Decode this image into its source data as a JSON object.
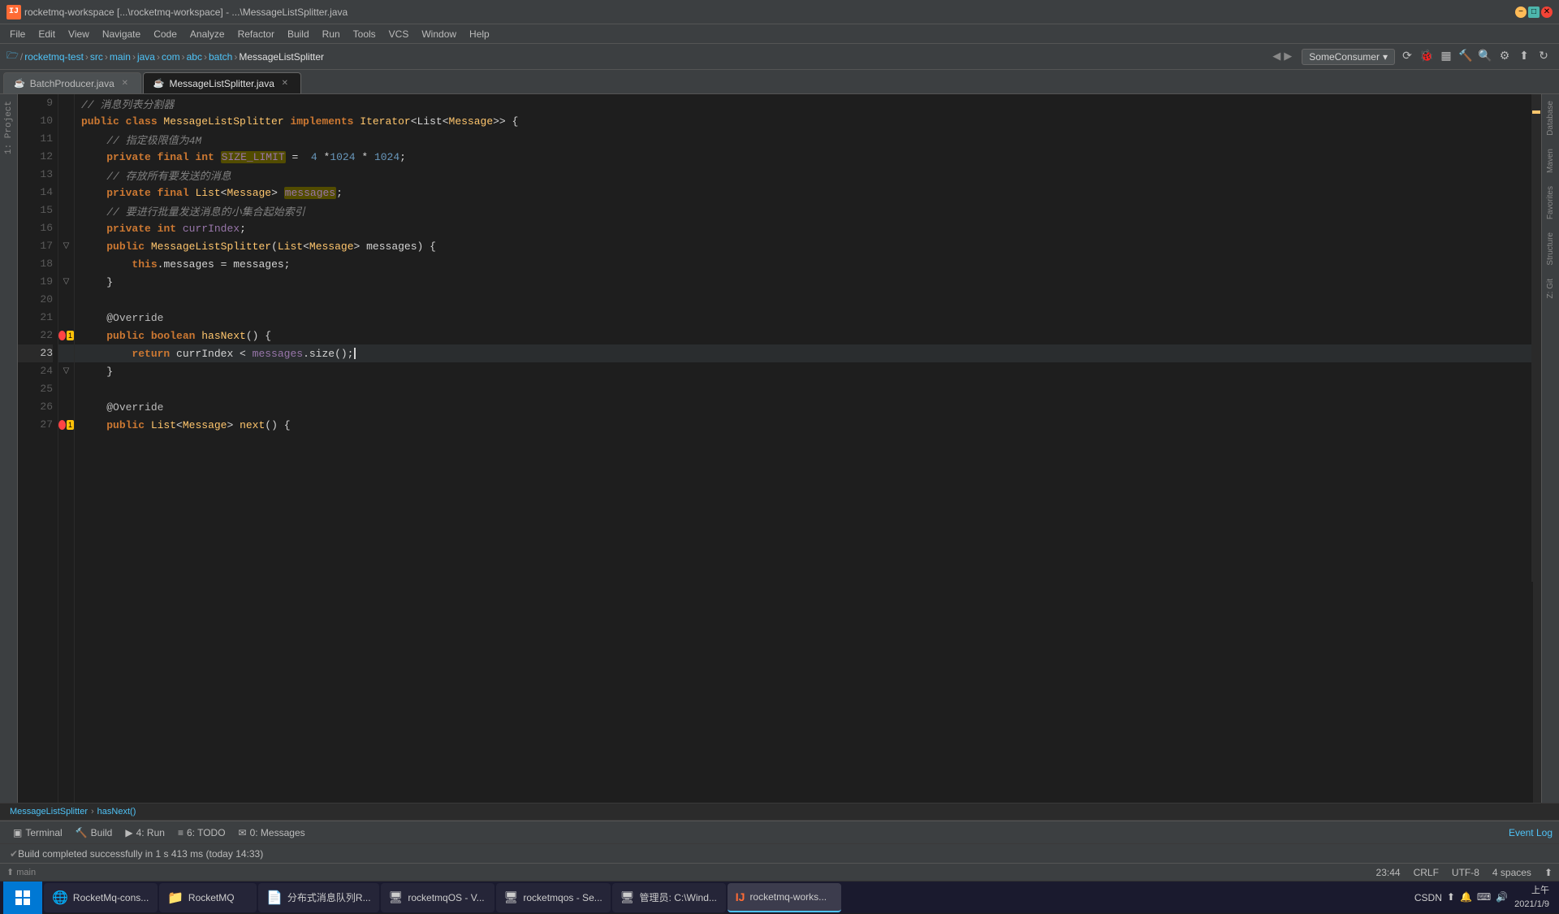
{
  "titlebar": {
    "title": "rocketmq-workspace [...\\rocketmq-workspace] - ...\\MessageListSplitter.java",
    "logo": "IJ"
  },
  "menubar": {
    "items": [
      "File",
      "Edit",
      "View",
      "Navigate",
      "Code",
      "Analyze",
      "Refactor",
      "Build",
      "Run",
      "Tools",
      "VCS",
      "Window",
      "Help"
    ]
  },
  "breadcrumb": {
    "items": [
      "rocketmq-test",
      "src",
      "main",
      "java",
      "com",
      "abc",
      "batch",
      "MessageListSplitter"
    ]
  },
  "toolbar": {
    "run_config": "SomeConsumer",
    "chevron": "▾"
  },
  "tabs": [
    {
      "name": "BatchProducer.java",
      "active": false,
      "icon": "☕"
    },
    {
      "name": "MessageListSplitter.java",
      "active": true,
      "icon": "☕"
    }
  ],
  "code": {
    "lines": [
      {
        "num": 9,
        "content": "// 消息列表分割器",
        "type": "comment"
      },
      {
        "num": 10,
        "content_parts": [
          {
            "text": "public ",
            "cls": "kw"
          },
          {
            "text": "class ",
            "cls": "kw"
          },
          {
            "text": "MessageListSplitter ",
            "cls": "type"
          },
          {
            "text": "implements ",
            "cls": "kw"
          },
          {
            "text": "Iterator",
            "cls": "type"
          },
          {
            "text": "<List<",
            "cls": "op"
          },
          {
            "text": "Message",
            "cls": "type"
          },
          {
            "text": ">> {",
            "cls": "op"
          }
        ]
      },
      {
        "num": 11,
        "content": "    // 指定极限值为4M",
        "type": "comment"
      },
      {
        "num": 12,
        "content_parts": [
          {
            "text": "    ",
            "cls": ""
          },
          {
            "text": "private ",
            "cls": "kw"
          },
          {
            "text": "final ",
            "cls": "kw"
          },
          {
            "text": "int ",
            "cls": "kw"
          },
          {
            "text": "SIZE_LIMIT",
            "cls": "field",
            "highlight": true
          },
          {
            "text": " = ",
            "cls": "op"
          },
          {
            "text": " 4 ",
            "cls": "num"
          },
          {
            "text": "*",
            "cls": "op"
          },
          {
            "text": "1024",
            "cls": "num"
          },
          {
            "text": " * ",
            "cls": "op"
          },
          {
            "text": "1024",
            "cls": "num"
          },
          {
            "text": ";",
            "cls": "op"
          }
        ]
      },
      {
        "num": 13,
        "content": "    // 存放所有要发送的消息",
        "type": "comment"
      },
      {
        "num": 14,
        "content_parts": [
          {
            "text": "    ",
            "cls": ""
          },
          {
            "text": "private ",
            "cls": "kw"
          },
          {
            "text": "final ",
            "cls": "kw"
          },
          {
            "text": "List",
            "cls": "type"
          },
          {
            "text": "<",
            "cls": "op"
          },
          {
            "text": "Message",
            "cls": "type"
          },
          {
            "text": "> ",
            "cls": "op"
          },
          {
            "text": "messages",
            "cls": "field",
            "highlight": true
          },
          {
            "text": ";",
            "cls": "op"
          }
        ]
      },
      {
        "num": 15,
        "content": "    // 要进行批量发送消息的小集合起始索引",
        "type": "comment"
      },
      {
        "num": 16,
        "content_parts": [
          {
            "text": "    ",
            "cls": ""
          },
          {
            "text": "private ",
            "cls": "kw"
          },
          {
            "text": "int ",
            "cls": "kw"
          },
          {
            "text": "currIndex",
            "cls": "field"
          },
          {
            "text": ";",
            "cls": "op"
          }
        ]
      },
      {
        "num": 17,
        "content_parts": [
          {
            "text": "    ",
            "cls": ""
          },
          {
            "text": "public ",
            "cls": "kw"
          },
          {
            "text": "MessageListSplitter",
            "cls": "method"
          },
          {
            "text": "(",
            "cls": "op"
          },
          {
            "text": "List",
            "cls": "type"
          },
          {
            "text": "<",
            "cls": "op"
          },
          {
            "text": "Message",
            "cls": "type"
          },
          {
            "text": "> messages) {",
            "cls": "op"
          }
        ],
        "has_fold": true
      },
      {
        "num": 18,
        "content_parts": [
          {
            "text": "        ",
            "cls": ""
          },
          {
            "text": "this",
            "cls": "kw"
          },
          {
            "text": ".messages = messages;",
            "cls": "var"
          }
        ]
      },
      {
        "num": 19,
        "content": "    }",
        "has_fold": true
      },
      {
        "num": 20,
        "content": ""
      },
      {
        "num": 21,
        "content_parts": [
          {
            "text": "    ",
            "cls": ""
          },
          {
            "text": "@Override",
            "cls": "annotation"
          }
        ]
      },
      {
        "num": 22,
        "content_parts": [
          {
            "text": "    ",
            "cls": ""
          },
          {
            "text": "public ",
            "cls": "kw"
          },
          {
            "text": "boolean ",
            "cls": "kw"
          },
          {
            "text": "hasNext",
            "cls": "method"
          },
          {
            "text": "() {",
            "cls": "op"
          }
        ],
        "breakpoint": true,
        "warning": true
      },
      {
        "num": 23,
        "content_parts": [
          {
            "text": "        ",
            "cls": ""
          },
          {
            "text": "return ",
            "cls": "kw"
          },
          {
            "text": "currIndex",
            "cls": "var"
          },
          {
            "text": " < ",
            "cls": "op"
          },
          {
            "text": "messages",
            "cls": "field"
          },
          {
            "text": ".size();",
            "cls": "op"
          }
        ],
        "active": true,
        "cursor_after": true
      },
      {
        "num": 24,
        "content": "    }",
        "has_fold": true
      },
      {
        "num": 25,
        "content": ""
      },
      {
        "num": 26,
        "content_parts": [
          {
            "text": "    ",
            "cls": ""
          },
          {
            "text": "@Override",
            "cls": "annotation"
          }
        ]
      },
      {
        "num": 27,
        "content_parts": [
          {
            "text": "    ",
            "cls": ""
          },
          {
            "text": "public ",
            "cls": "kw"
          },
          {
            "text": "List",
            "cls": "type"
          },
          {
            "text": "<",
            "cls": "op"
          },
          {
            "text": "Message",
            "cls": "type"
          },
          {
            "text": "> ",
            "cls": "op"
          },
          {
            "text": "next",
            "cls": "method"
          },
          {
            "text": "() {",
            "cls": "op"
          }
        ],
        "breakpoint": true,
        "warning": true
      }
    ]
  },
  "navbar": {
    "class": "MessageListSplitter",
    "method": "hasNext()"
  },
  "status_tabs": [
    {
      "icon": "▣",
      "label": "Terminal",
      "active": false
    },
    {
      "icon": "🔨",
      "label": "Build",
      "active": false
    },
    {
      "icon": "▶",
      "label": "4: Run",
      "active": false
    },
    {
      "icon": "≡",
      "label": "6: TODO",
      "active": false
    },
    {
      "icon": "✉",
      "label": "0: Messages",
      "active": false
    }
  ],
  "status_right": {
    "event_log": "Event Log"
  },
  "build_status": {
    "text": "Build completed successfully in 1 s 413 ms (today 14:33)"
  },
  "status_bar": {
    "line_col": "23:44",
    "crlf": "CRLF",
    "encoding": "UTF-8",
    "indent": "4 spaces",
    "git": "⬆"
  },
  "taskbar": {
    "apps": [
      {
        "icon": "🟠",
        "label": "RocketMq-cons...",
        "active": false
      },
      {
        "icon": "📁",
        "label": "RocketMQ",
        "active": false
      },
      {
        "icon": "T",
        "label": "分布式消息队列R...",
        "active": false
      },
      {
        "icon": "🖥",
        "label": "rocketmqOS - V...",
        "active": false
      },
      {
        "icon": "🖥",
        "label": "rocketmqos - Se...",
        "active": false
      },
      {
        "icon": "🖥",
        "label": "管理员: C:\\Wind...",
        "active": false
      },
      {
        "icon": "IJ",
        "label": "rocketmq-works...",
        "active": true
      }
    ],
    "time": "上午",
    "date": "2021/1/9",
    "tray": [
      "CSDN",
      "⬆",
      "🔔",
      "⌨",
      "🔊"
    ]
  },
  "right_panel": {
    "labels": [
      "Database",
      "Maven",
      "Favorites",
      "Structure",
      "Z: Git"
    ]
  }
}
